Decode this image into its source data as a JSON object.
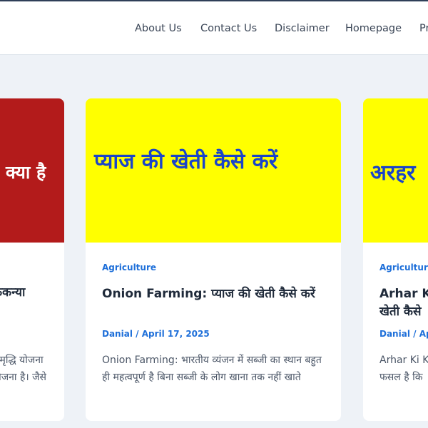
{
  "nav": {
    "items": [
      "About Us",
      "Contact Us",
      "Disclaimer",
      "Homepage",
      "Pr"
    ]
  },
  "cards": [
    {
      "thumb_text": "क्या है",
      "thumb_bg": "#b31b1b",
      "thumb_color": "#ffffff",
      "title": "कुकन्या",
      "excerpt": "समृद्धि योजना\nयोजना है। जैसे"
    },
    {
      "thumb_text": "प्याज की खेती कैसे करें",
      "thumb_bg": "#ffff00",
      "thumb_color": "#1a44c9",
      "category": "Agriculture",
      "title": "Onion Farming: प्याज की खेती कैसे करें",
      "author": "Danial",
      "date": "April 17, 2025",
      "excerpt": "Onion Farming: भारतीय व्यंजन में सब्जी का स्थान बहुत ही महत्वपूर्ण है बिना सब्जी के लोग खाना तक नहीं खाते"
    },
    {
      "thumb_text": "अरहर",
      "thumb_bg": "#ffff00",
      "thumb_color": "#1a44c9",
      "category": "Agriculture",
      "title": "Arhar Ki\nखेती कैसे",
      "author": "Danial",
      "date": "Apr",
      "excerpt": "Arhar Ki Kh\nफसल है कि"
    }
  ]
}
